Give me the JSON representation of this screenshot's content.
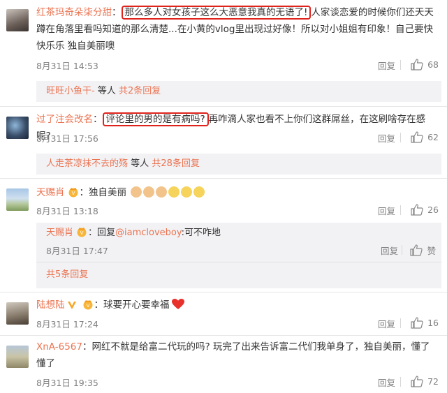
{
  "comments": [
    {
      "username": "红茶玛奇朵柒分甜",
      "highlight": "那么多人对女孩子这么大恶意我真的无语了!",
      "text_rest": "人家谈恋爱的时候你们还天天蹲在角落里看吗知道的那么清楚...在小黄的vlog里出现过好像！所以对小姐姐有印象！自己要快快乐乐 独自美丽噢",
      "time": "8月31日 14:53",
      "reply_label": "回复",
      "likes": "68",
      "sub": {
        "user": "旺旺小鱼干-",
        "middle": "等人",
        "count": "共2条回复"
      }
    },
    {
      "username": "过了注会改名",
      "highlight": "评论里的男的是有病吗?",
      "text_rest": "再咋滴人家也看不上你们这群屌丝，在这刷啥存在感呢?",
      "time": "8月31日 17:56",
      "reply_label": "回复",
      "likes": "62",
      "sub": {
        "user": "人走茶凉抹不去的殇",
        "middle": "等人",
        "count": "共28条回复"
      }
    },
    {
      "username": "天赐肖",
      "text": "：独自美丽",
      "time": "8月31日 13:18",
      "reply_label": "回复",
      "likes": "26",
      "nested": {
        "username": "天赐肖",
        "reply_word": "：回复",
        "mention": "@iamcloveboy",
        "text": ":可不咋地",
        "time": "8月31日 17:47",
        "reply_label": "回复",
        "like_label": "赞"
      },
      "more": "共5条回复"
    },
    {
      "username": "陆想陆",
      "text": "：球要开心要幸福",
      "time": "8月31日 17:24",
      "reply_label": "回复",
      "likes": "16"
    },
    {
      "username": "XnA-6567",
      "text": "：网红不就是给富二代玩的吗? 玩完了出来告诉富二代们我单身了，独自美丽，懂了懂了",
      "time": "8月31日 19:35",
      "reply_label": "回复",
      "likes": "72"
    }
  ],
  "colors": {
    "username": "#eb7350",
    "highlight_border": "#e0221c",
    "meta": "#808080",
    "subbox": "#f2f2f5"
  },
  "icons": [
    "thumbs-up-icon",
    "vip-crown-icon",
    "heart-icon",
    "emoji-icon"
  ]
}
